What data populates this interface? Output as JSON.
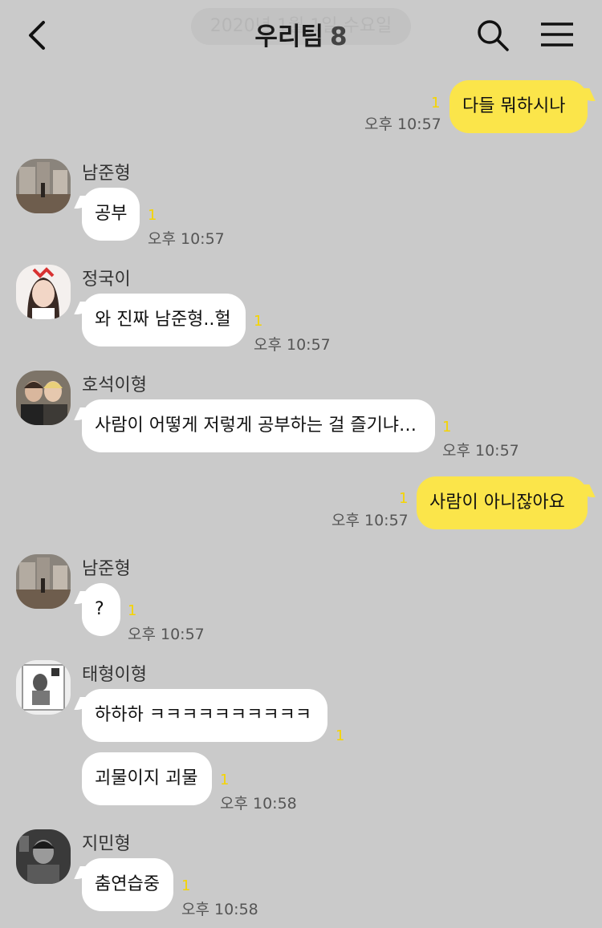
{
  "header": {
    "date_overlay": "2020년 1월 1일 수요일",
    "title": "우리팀",
    "member_count": "8"
  },
  "icons": {
    "back": "back-chevron-icon",
    "search": "search-icon",
    "menu": "hamburger-menu-icon"
  },
  "messages": [
    {
      "sender": "me",
      "text": "다들 뭐하시나",
      "unread": "1",
      "time": "오후 10:57"
    },
    {
      "sender": "남준형",
      "text": "공부",
      "unread": "1",
      "time": "오후 10:57"
    },
    {
      "sender": "정국이",
      "text": "와 진짜 남준형..헐",
      "unread": "1",
      "time": "오후 10:57"
    },
    {
      "sender": "호석이형",
      "text": "사람이 어떻게 저렇게 공부하는 걸 즐기냐…",
      "unread": "1",
      "time": "오후 10:57"
    },
    {
      "sender": "me",
      "text": "사람이 아니잖아요",
      "unread": "1",
      "time": "오후 10:57"
    },
    {
      "sender": "남준형",
      "text": "?",
      "unread": "1",
      "time": "오후 10:57"
    },
    {
      "sender": "태형이형",
      "text": "하하하 ㅋㅋㅋㅋㅋㅋㅋㅋㅋㅋ",
      "unread": "1",
      "time": ""
    },
    {
      "sender": "태형이형",
      "text": "괴물이지 괴물",
      "unread": "1",
      "time": "오후 10:58"
    },
    {
      "sender": "지민형",
      "text": "춤연습중",
      "unread": "1",
      "time": "오후 10:58"
    }
  ],
  "colors": {
    "background": "#cacaca",
    "my_bubble": "#fbe54a",
    "other_bubble": "#ffffff",
    "unread_count": "#f5d400"
  }
}
